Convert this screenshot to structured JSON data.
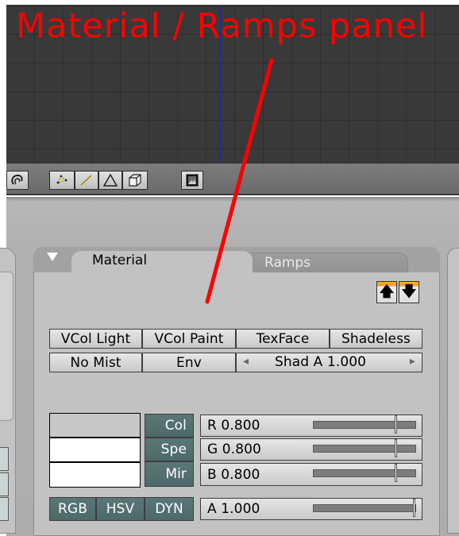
{
  "annotation": {
    "title": "Material / Ramps panel",
    "color": "#ff0000"
  },
  "header": {
    "buttons": [
      {
        "name": "snap-magnet-icon",
        "glyph": "↻"
      },
      {
        "name": "vertex-select-icon"
      },
      {
        "name": "edge-select-icon"
      },
      {
        "name": "face-select-icon"
      },
      {
        "name": "cube-occlude-icon"
      },
      {
        "name": "render-image-icon"
      }
    ]
  },
  "panel": {
    "tabs": [
      {
        "label": "Material",
        "active": true
      },
      {
        "label": "Ramps",
        "active": false
      }
    ],
    "arrows": {
      "up": "🡅",
      "down": "🡇"
    }
  },
  "toggles_row1": [
    "VCol Light",
    "VCol Paint",
    "TexFace",
    "Shadeless"
  ],
  "toggles_row2": {
    "no_mist": "No Mist",
    "env": "Env",
    "shad_a": "Shad A 1.000",
    "left_arrow": "◂",
    "right_arrow": "▸"
  },
  "color_buttons": [
    "Col",
    "Spe",
    "Mir"
  ],
  "rgb": [
    {
      "label": "R 0.800",
      "value": 0.8
    },
    {
      "label": "G 0.800",
      "value": 0.8
    },
    {
      "label": "B 0.800",
      "value": 0.8
    }
  ],
  "alpha": {
    "label": "A 1.000",
    "value": 1.0
  },
  "color_modes": [
    {
      "label": "RGB",
      "selected": true
    },
    {
      "label": "HSV",
      "selected": false
    },
    {
      "label": "DYN",
      "selected": false
    }
  ],
  "swatches": [
    "#c8c8c8",
    "#ffffff",
    "#ffffff"
  ],
  "colors": {
    "selected_button": "#5a7676",
    "orange_accent": "#f0a020"
  }
}
